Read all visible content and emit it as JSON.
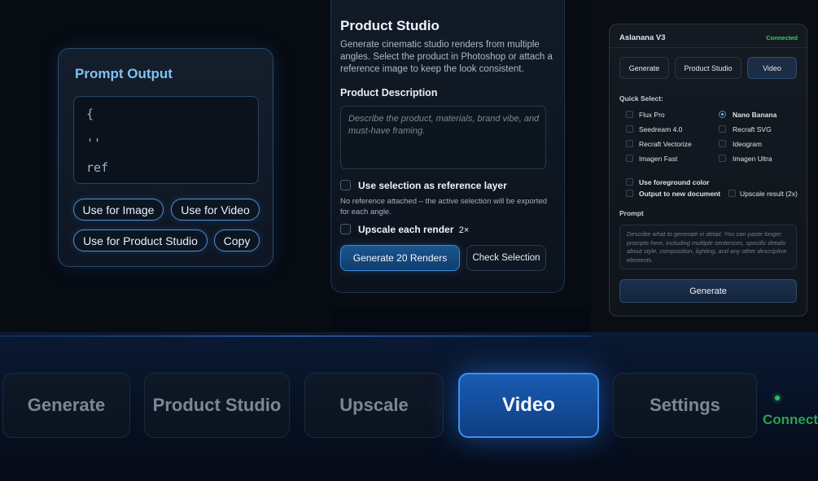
{
  "prompt_output": {
    "title": "Prompt Output",
    "code_lines": [
      "{",
      "''",
      "ref"
    ],
    "buttons": {
      "use_for_image": "Use for Image",
      "use_for_video": "Use for Video",
      "use_for_product_studio": "Use for Product Studio",
      "copy": "Copy"
    }
  },
  "product_studio": {
    "title": "Product Studio",
    "description": "Generate cinematic studio renders from multiple angles. Select the product in Photoshop or attach a reference image to keep the look consistent.",
    "field_label": "Product Description",
    "field_placeholder": "Describe the product, materials, brand vibe, and must-have framing.",
    "use_selection_label": "Use selection as reference layer",
    "reference_note": "No reference attached – the active selection will be exported for each angle.",
    "upscale_label": "Upscale each render",
    "upscale_suffix": "2×",
    "generate_button": "Generate 20 Renders",
    "check_button": "Check Selection"
  },
  "aslanana": {
    "title": "Aslanana V3",
    "status": "Connected",
    "tabs": [
      "Generate",
      "Product Studio",
      "Video"
    ],
    "active_tab": "Video",
    "quick_select_label": "Quick Select:",
    "models": [
      "Flux Pro",
      "Nano Banana",
      "Seedream 4.0",
      "Recraft SVG",
      "Recraft Vectorize",
      "Ideogram",
      "Imagen Fast",
      "Imagen Ultra"
    ],
    "selected_model": "Nano Banana",
    "use_foreground": "Use foreground color",
    "output_new_doc": "Output to new document",
    "upscale_result": "Upscale result (2x)",
    "prompt_label": "Prompt",
    "prompt_placeholder": "Describe what to generate in detail. You can paste longer prompts here, including multiple sentences, specific details about style, composition, lighting, and any other descriptive elements.",
    "generate_button": "Generate"
  },
  "bottom_bar": {
    "tabs": [
      "Generate",
      "Product Studio",
      "Upscale",
      "Video",
      "Settings"
    ],
    "active_tab": "Video",
    "status": "Connect"
  },
  "colors": {
    "accent_blue": "#3d91ee",
    "connected_green": "#2fbd5e",
    "prompt_title": "#7fc2f2"
  }
}
